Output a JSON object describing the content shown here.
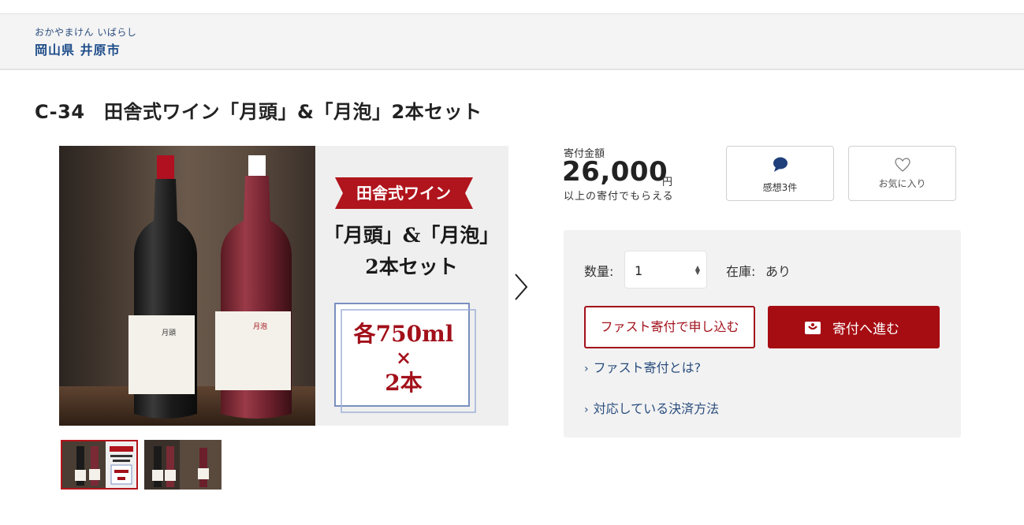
{
  "municipality": {
    "kana": "おかやまけん いばらし",
    "name": "岡山県 井原市"
  },
  "product": {
    "title": "C-34　田舎式ワイン「月頭」&「月泡」2本セット"
  },
  "banner": {
    "brand": "田舎式ワイン",
    "line1": "「月頭」&「月泡」",
    "line2": "2本セット",
    "volume": "各750ml",
    "times": "×",
    "count": "2本",
    "label_left": "月頭",
    "label_right": "月泡"
  },
  "gallery": {
    "next_icon": "chevron-right-icon",
    "selected_index": 0
  },
  "donation": {
    "label": "寄付金額",
    "amount": "26,000",
    "unit": "円",
    "note": "以上の寄付でもらえる"
  },
  "actions": {
    "review_label": "感想3件",
    "review_icon": "speech-bubble-icon",
    "favorite_label": "お気に入り",
    "favorite_icon": "heart-icon"
  },
  "order": {
    "qty_label": "数量:",
    "qty_value": "1",
    "stock_label": "在庫:",
    "stock_value": "あり",
    "fast_button": "ファスト寄付で申し込む",
    "donate_button": "寄付へ進む",
    "donate_icon": "gift-icon",
    "link_fast": "ファスト寄付とは?",
    "link_payment": "対応している決済方法"
  },
  "colors": {
    "accent_red": "#a60d12",
    "link_blue": "#2a4d7e",
    "title_blue": "#1e4d8a"
  }
}
